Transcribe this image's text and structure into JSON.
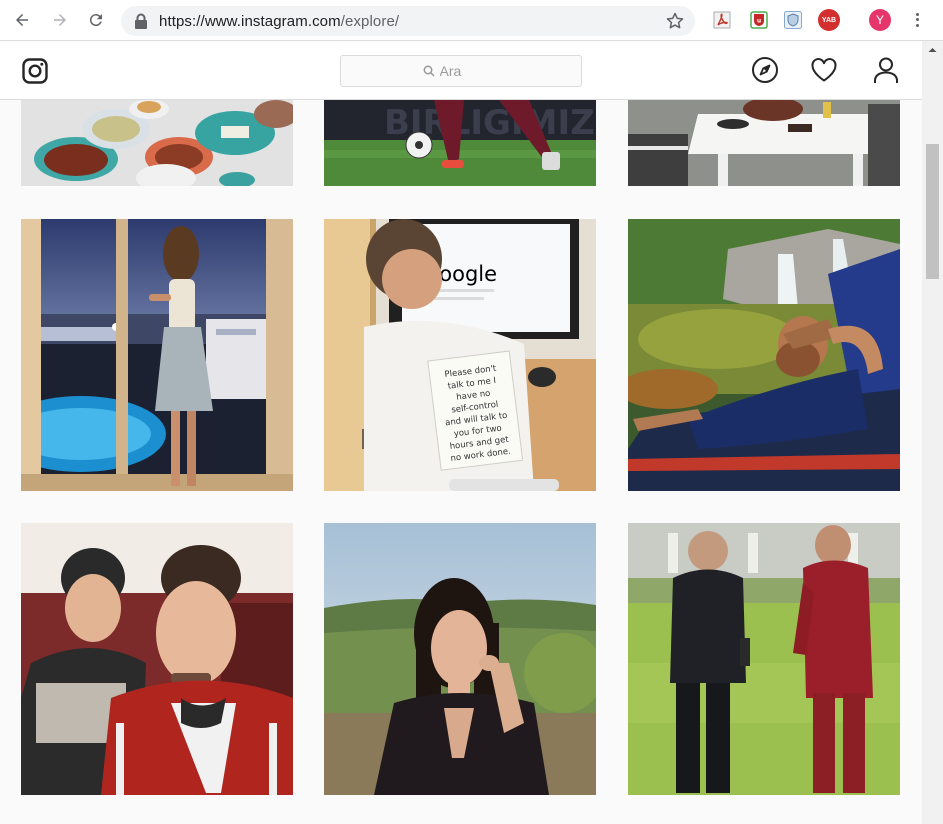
{
  "browser": {
    "url_host": "https://www.instagram.com",
    "url_path": "/explore/",
    "profile_initial": "Y",
    "ext_badge": "YAB"
  },
  "search": {
    "placeholder": "Ara"
  },
  "explore": {
    "posts": [
      {
        "id": "food-table"
      },
      {
        "id": "football-player"
      },
      {
        "id": "restaurant-tables"
      },
      {
        "id": "woman-window-pool"
      },
      {
        "id": "google-shirt-note",
        "text": "Please don't talk to me I have no self-control and will talk to you for two hours and get no work done.",
        "screen_text": "Google"
      },
      {
        "id": "man-hammock-waterfall"
      },
      {
        "id": "two-guys-selfie"
      },
      {
        "id": "woman-portrait-hills"
      },
      {
        "id": "coaches-talking-pitch"
      }
    ]
  }
}
